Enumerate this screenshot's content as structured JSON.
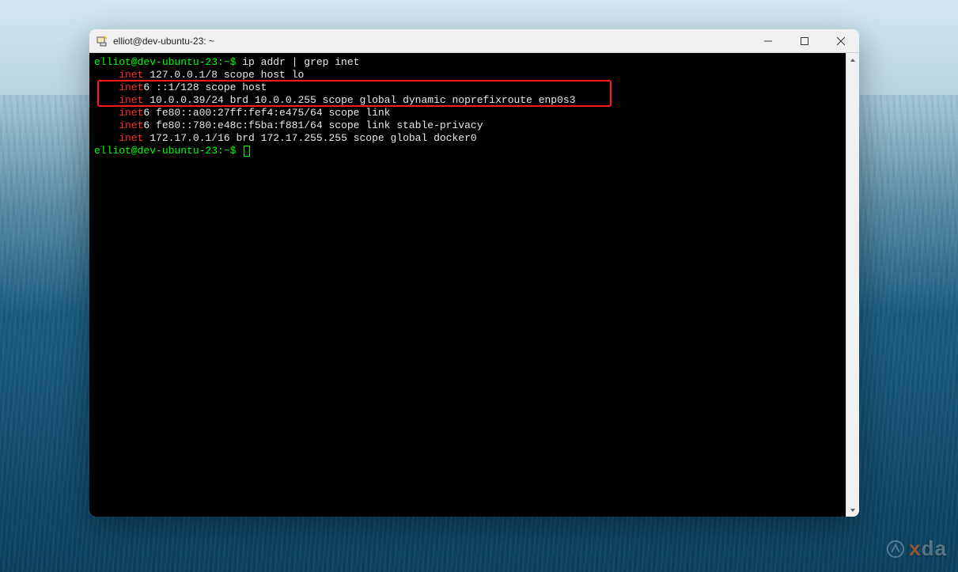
{
  "window": {
    "title": "elliot@dev-ubuntu-23: ~"
  },
  "terminal": {
    "prompt": "elliot@dev-ubuntu-23:~$",
    "command": "ip addr | grep inet",
    "lines": [
      {
        "kw": "inet",
        "rest": "127.0.0.1/8 scope host lo"
      },
      {
        "kw": "inet",
        "rest": "6 ::1/128 scope host"
      },
      {
        "kw": "inet",
        "rest": "10.0.0.39/24 brd 10.0.0.255 scope global dynamic noprefixroute enp0s3"
      },
      {
        "kw": "inet",
        "rest": "6 fe80::a00:27ff:fef4:e475/64 scope link"
      },
      {
        "kw": "inet",
        "rest": "6 fe80::780:e48c:f5ba:f881/64 scope link stable-privacy"
      },
      {
        "kw": "inet",
        "rest": "172.17.0.1/16 brd 172.17.255.255 scope global docker0"
      }
    ],
    "highlight_lines": {
      "start": 1,
      "end": 2
    }
  },
  "watermark": {
    "brand_prefix": "",
    "brand_x": "x",
    "brand_rest": "da"
  }
}
